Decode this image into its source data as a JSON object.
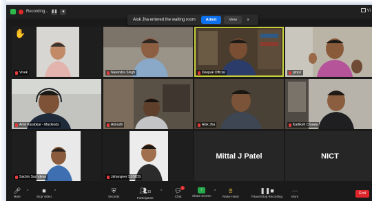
{
  "window": {
    "recording_label": "Recording...",
    "view_label": "Vi"
  },
  "notification": {
    "text": "Alok Jha entered the waiting room",
    "admit_label": "Admit",
    "view_label": "View",
    "close_label": "×"
  },
  "participants": [
    {
      "name": "Vivek"
    },
    {
      "name": "Narendra Singh"
    },
    {
      "name": "Deepak Official"
    },
    {
      "name": "gmp2"
    },
    {
      "name": "Amit Karabkar - Macleods"
    },
    {
      "name": "Anirudh"
    },
    {
      "name": "Alok Jha"
    },
    {
      "name": "Kartikeh Chawla"
    },
    {
      "name": "Sachin Sachdeva"
    },
    {
      "name": "Jahangeer SSSIDS"
    },
    {
      "name": "Mittal J Patel"
    },
    {
      "name": "NICT"
    }
  ],
  "toolbar": {
    "mute": "Mute",
    "stop_video": "Stop Video",
    "security": "Security",
    "participants": "Participants",
    "participants_count": "15",
    "chat": "Chat",
    "chat_badge": "1",
    "share_screen": "Share Screen",
    "raise_hand": "Raise Hand",
    "pause_recording": "Pause/Stop Recording",
    "more": "More",
    "end": "End"
  },
  "colors": {
    "admit": "#0e71eb",
    "active_speaker": "#c9d23a",
    "end": "#e0262a",
    "share": "#23a94a"
  }
}
